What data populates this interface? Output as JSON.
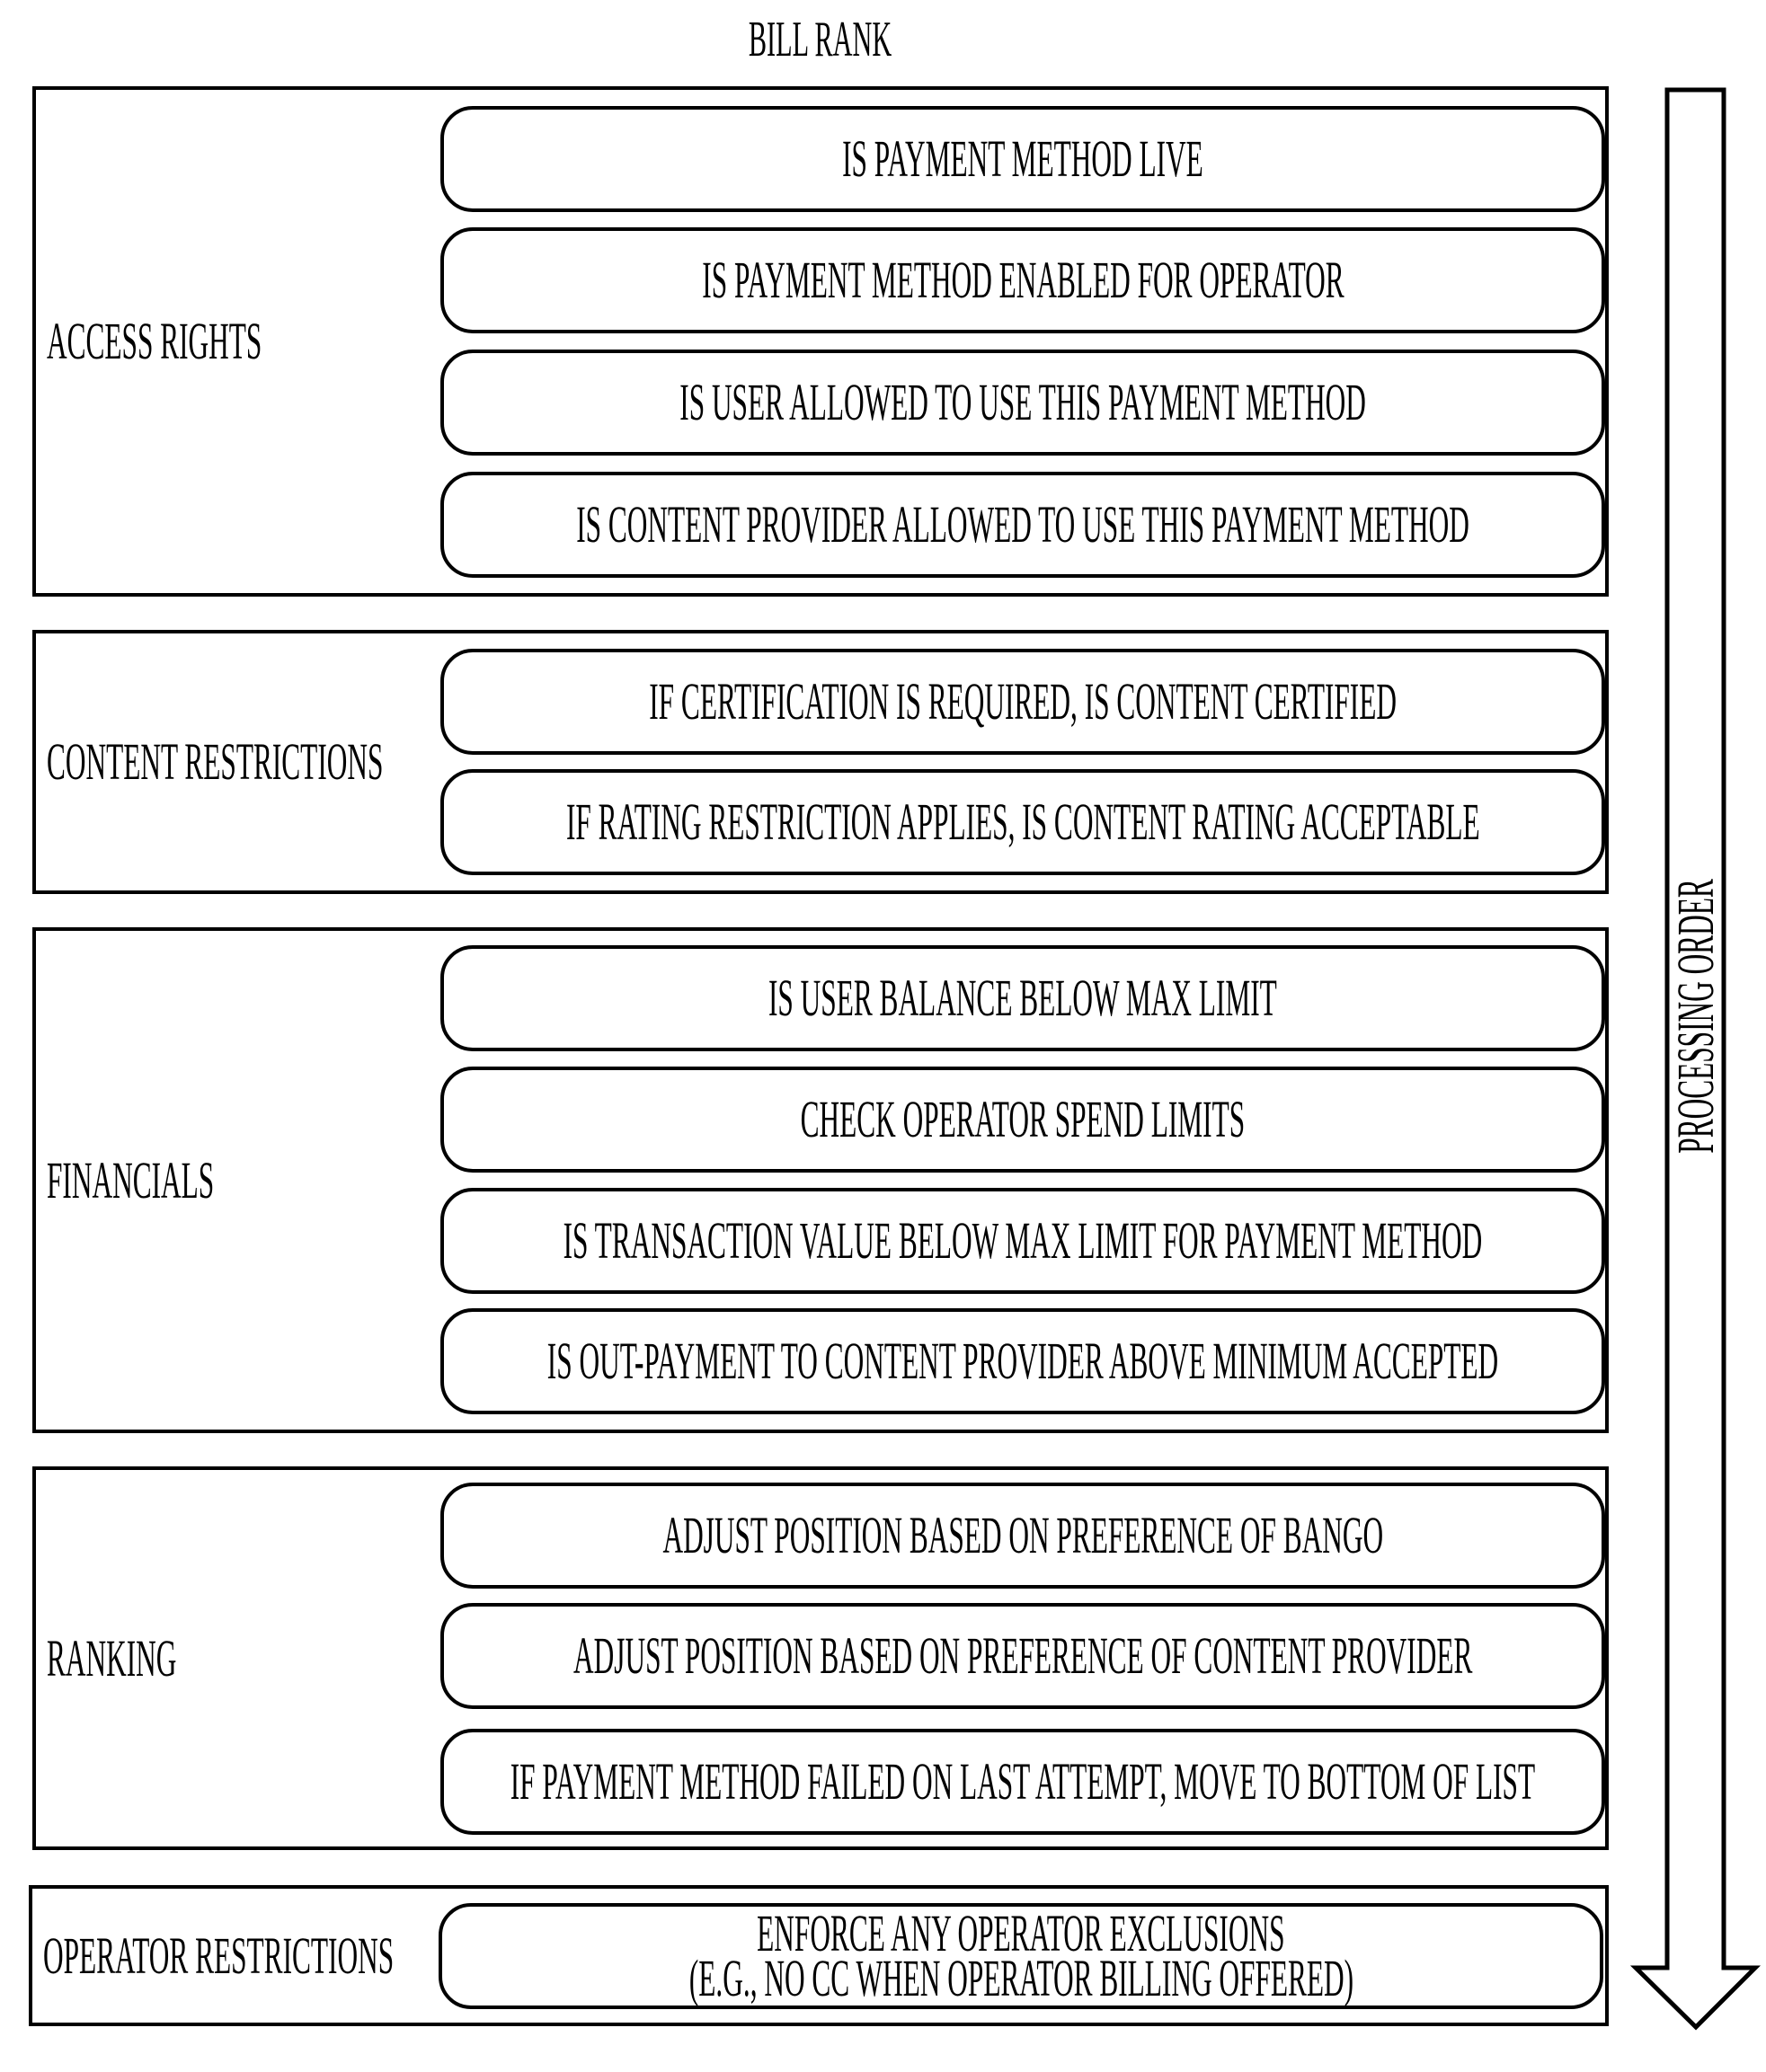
{
  "title": "BILL RANK",
  "processing_order_label": "PROCESSING ORDER",
  "groups": [
    {
      "label": "ACCESS RIGHTS",
      "checks": [
        "IS PAYMENT METHOD LIVE",
        "IS PAYMENT METHOD ENABLED FOR OPERATOR",
        "IS USER ALLOWED TO USE THIS PAYMENT METHOD",
        "IS CONTENT PROVIDER ALLOWED TO USE THIS PAYMENT METHOD"
      ]
    },
    {
      "label": "CONTENT RESTRICTIONS",
      "checks": [
        "IF CERTIFICATION IS REQUIRED, IS CONTENT CERTIFIED",
        "IF RATING RESTRICTION APPLIES, IS CONTENT RATING ACCEPTABLE"
      ]
    },
    {
      "label": "FINANCIALS",
      "checks": [
        "IS USER BALANCE BELOW MAX LIMIT",
        "CHECK OPERATOR SPEND LIMITS",
        "IS TRANSACTION VALUE BELOW MAX LIMIT FOR PAYMENT METHOD",
        "IS OUT-PAYMENT TO CONTENT PROVIDER ABOVE MINIMUM ACCEPTED"
      ]
    },
    {
      "label": "RANKING",
      "checks": [
        "ADJUST POSITION BASED ON PREFERENCE OF BANGO",
        "ADJUST POSITION BASED ON PREFERENCE OF CONTENT PROVIDER",
        "IF PAYMENT METHOD FAILED ON LAST ATTEMPT, MOVE TO BOTTOM OF LIST"
      ]
    },
    {
      "label": "OPERATOR RESTRICTIONS",
      "checks": [
        {
          "line1": "ENFORCE ANY OPERATOR EXCLUSIONS",
          "line2": "(E.G., NO CC WHEN OPERATOR BILLING OFFERED)"
        }
      ]
    }
  ]
}
